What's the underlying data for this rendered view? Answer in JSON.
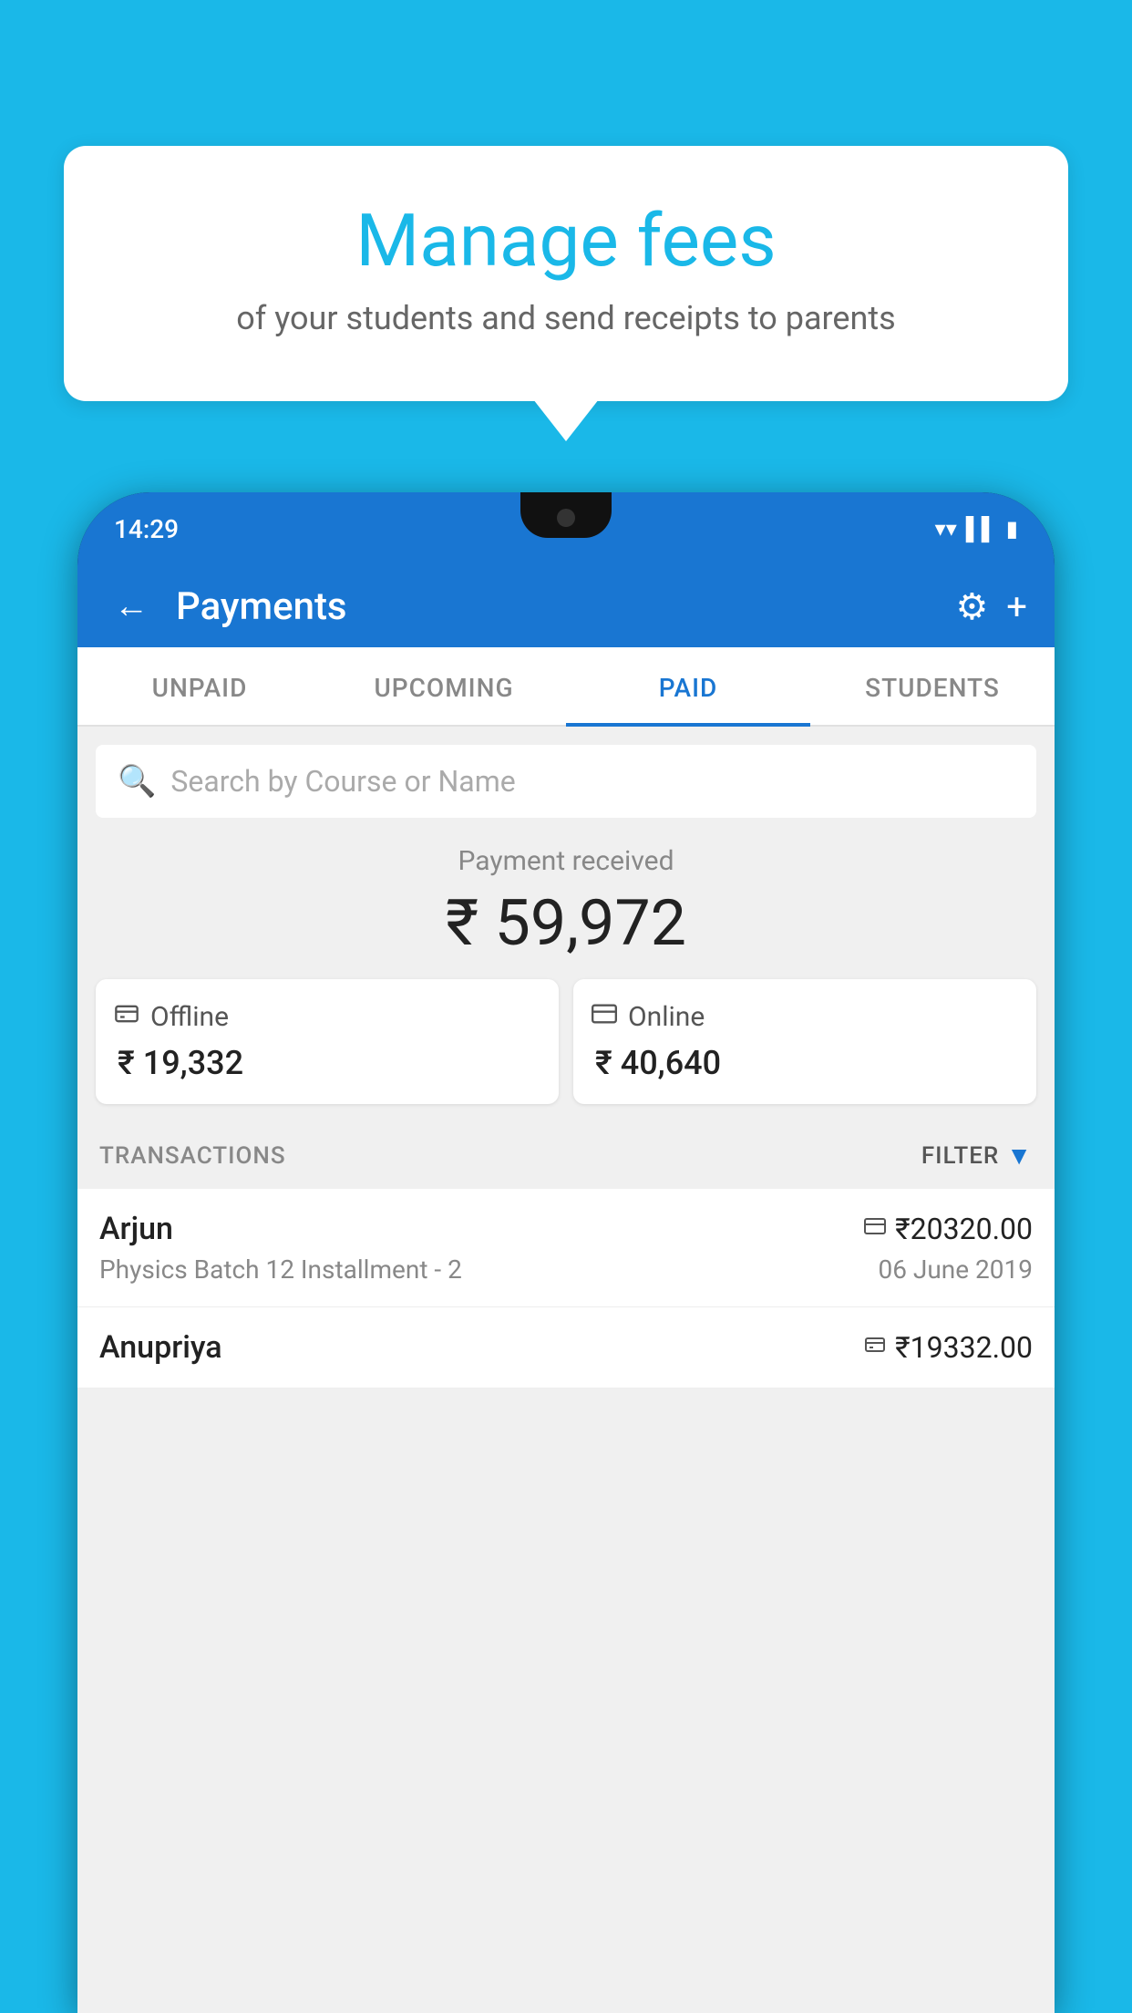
{
  "background_color": "#1ab8e8",
  "tooltip": {
    "title": "Manage fees",
    "subtitle": "of your students and send receipts to parents"
  },
  "phone": {
    "status_bar": {
      "time": "14:29"
    },
    "header": {
      "title": "Payments",
      "back_label": "←",
      "gear_label": "⚙",
      "plus_label": "+"
    },
    "tabs": [
      {
        "label": "UNPAID",
        "active": false
      },
      {
        "label": "UPCOMING",
        "active": false
      },
      {
        "label": "PAID",
        "active": true
      },
      {
        "label": "STUDENTS",
        "active": false
      }
    ],
    "search": {
      "placeholder": "Search by Course or Name"
    },
    "payment_received": {
      "label": "Payment received",
      "amount": "₹ 59,972"
    },
    "payment_cards": [
      {
        "icon": "₹",
        "label": "Offline",
        "amount": "₹ 19,332"
      },
      {
        "icon": "▭",
        "label": "Online",
        "amount": "₹ 40,640"
      }
    ],
    "transactions_header": {
      "label": "TRANSACTIONS",
      "filter_label": "FILTER"
    },
    "transactions": [
      {
        "name": "Arjun",
        "amount_icon": "▭",
        "amount": "₹20320.00",
        "course": "Physics Batch 12 Installment - 2",
        "date": "06 June 2019"
      },
      {
        "name": "Anupriya",
        "amount_icon": "₹",
        "amount": "₹19332.00",
        "course": "",
        "date": ""
      }
    ]
  }
}
